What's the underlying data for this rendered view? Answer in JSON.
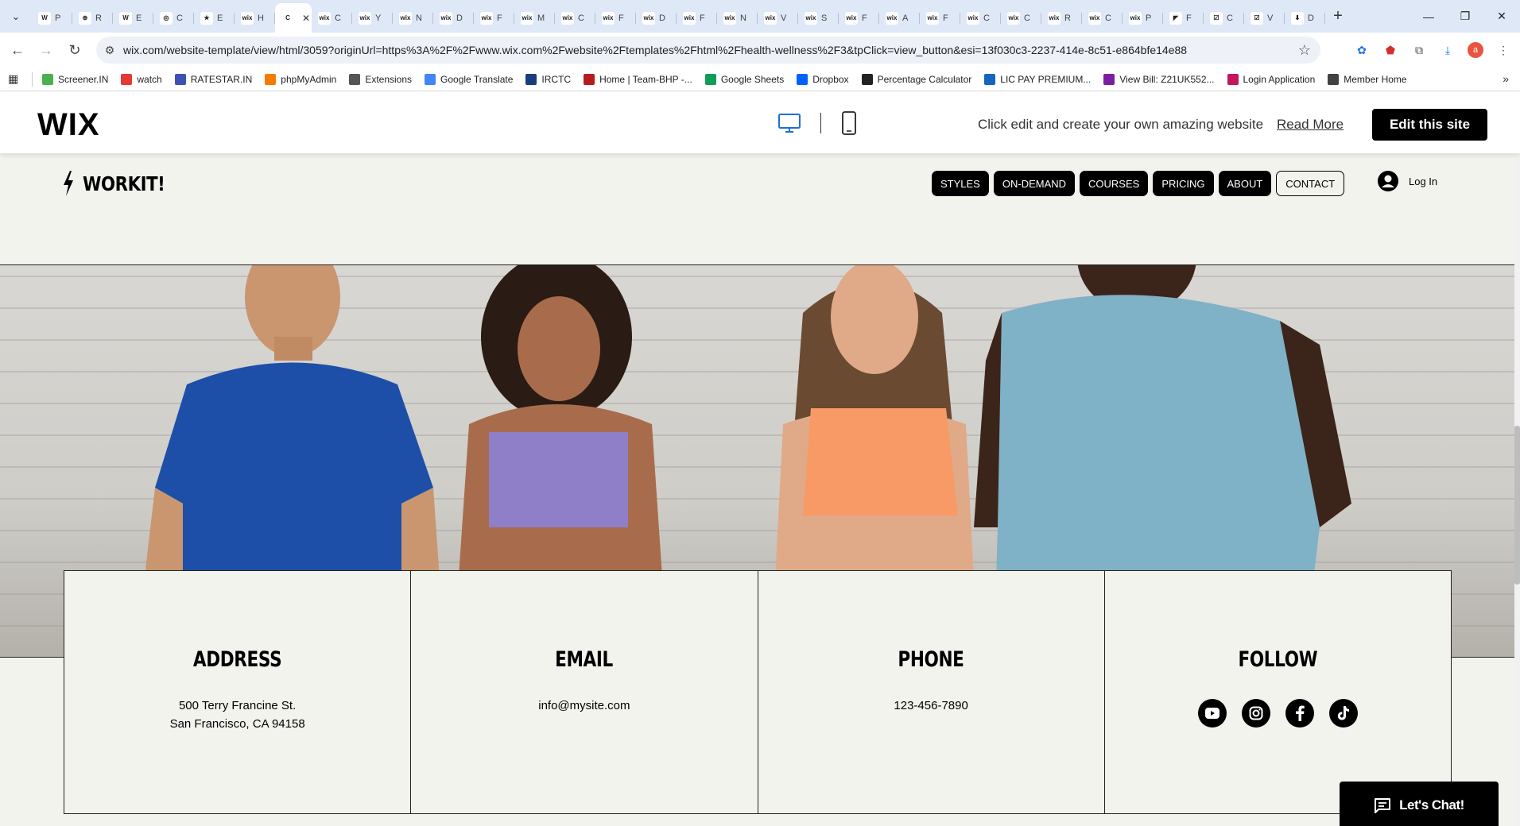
{
  "browser": {
    "tabs": [
      {
        "icon": "W",
        "label": "P"
      },
      {
        "icon": "⊕",
        "label": "R"
      },
      {
        "icon": "W",
        "label": "E"
      },
      {
        "icon": "◎",
        "label": "C"
      },
      {
        "icon": "★",
        "label": "E"
      },
      {
        "icon": "wix",
        "label": "H"
      },
      {
        "icon": "C",
        "label": "",
        "active": true
      },
      {
        "icon": "wix",
        "label": "C"
      },
      {
        "icon": "wix",
        "label": "Y"
      },
      {
        "icon": "wix",
        "label": "N"
      },
      {
        "icon": "wix",
        "label": "D"
      },
      {
        "icon": "wix",
        "label": "F"
      },
      {
        "icon": "wix",
        "label": "M"
      },
      {
        "icon": "wix",
        "label": "C"
      },
      {
        "icon": "wix",
        "label": "F"
      },
      {
        "icon": "wix",
        "label": "D"
      },
      {
        "icon": "wix",
        "label": "F"
      },
      {
        "icon": "wix",
        "label": "N"
      },
      {
        "icon": "wix",
        "label": "V"
      },
      {
        "icon": "wix",
        "label": "S"
      },
      {
        "icon": "wix",
        "label": "F"
      },
      {
        "icon": "wix",
        "label": "A"
      },
      {
        "icon": "wix",
        "label": "F"
      },
      {
        "icon": "wix",
        "label": "C"
      },
      {
        "icon": "wix",
        "label": "C"
      },
      {
        "icon": "wix",
        "label": "R"
      },
      {
        "icon": "wix",
        "label": "C"
      },
      {
        "icon": "wix",
        "label": "P"
      },
      {
        "icon": "◤",
        "label": "F"
      },
      {
        "icon": "☑",
        "label": "C"
      },
      {
        "icon": "☑",
        "label": "V"
      },
      {
        "icon": "⬇",
        "label": "D"
      }
    ],
    "url": "wix.com/website-template/view/html/3059?originUrl=https%3A%2F%2Fwww.wix.com%2Fwebsite%2Ftemplates%2Fhtml%2Fhealth-wellness%2F3&tpClick=view_button&esi=13f030c3-2237-414e-8c51-e864bfe14e88",
    "profile_initial": "a",
    "bookmarks": [
      {
        "label": "Screener.IN",
        "color": "#4caf50"
      },
      {
        "label": "watch",
        "color": "#e53935"
      },
      {
        "label": "RATESTAR.IN",
        "color": "#3f51b5"
      },
      {
        "label": "phpMyAdmin",
        "color": "#f57c00"
      },
      {
        "label": "Extensions",
        "color": "#555555"
      },
      {
        "label": "Google Translate",
        "color": "#4285f4"
      },
      {
        "label": "IRCTC",
        "color": "#1a3d7c"
      },
      {
        "label": "Home | Team-BHP -...",
        "color": "#b71c1c"
      },
      {
        "label": "Google Sheets",
        "color": "#0f9d58"
      },
      {
        "label": "Dropbox",
        "color": "#0061ff"
      },
      {
        "label": "Percentage Calculator",
        "color": "#222222"
      },
      {
        "label": "LIC PAY PREMIUM...",
        "color": "#1565c0"
      },
      {
        "label": "View Bill: Z21UK552...",
        "color": "#7b1fa2"
      },
      {
        "label": "Login Application",
        "color": "#c2185b"
      },
      {
        "label": "Member Home",
        "color": "#424242"
      }
    ]
  },
  "wixbar": {
    "logo": "WIX",
    "message": "Click edit and create your own amazing website",
    "read_more": "Read More",
    "edit_button": "Edit this site"
  },
  "site": {
    "brand": "WORKIT!",
    "nav": [
      {
        "label": "STYLES"
      },
      {
        "label": "ON-DEMAND"
      },
      {
        "label": "COURSES"
      },
      {
        "label": "PRICING"
      },
      {
        "label": "ABOUT"
      },
      {
        "label": "CONTACT",
        "outline": true
      }
    ],
    "login_label": "Log In",
    "contact": {
      "address": {
        "title": "ADDRESS",
        "line1": "500 Terry Francine St.",
        "line2": "San Francisco, CA 94158"
      },
      "email": {
        "title": "EMAIL",
        "value": "info@mysite.com"
      },
      "phone": {
        "title": "PHONE",
        "value": "123-456-7890"
      },
      "follow": {
        "title": "FOLLOW",
        "icons": [
          "youtube-icon",
          "instagram-icon",
          "facebook-icon",
          "tiktok-icon"
        ]
      }
    },
    "chat_label": "Let's Chat!",
    "colors": {
      "background": "#f3f3ee",
      "accent": "#000000"
    }
  }
}
